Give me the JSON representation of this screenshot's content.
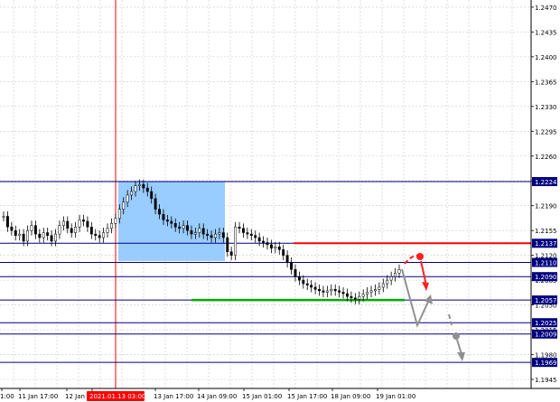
{
  "chart_data": {
    "type": "candlestick",
    "title": "",
    "xlabel": "",
    "ylabel": "",
    "ylim": [
      1.1945,
      1.2475
    ],
    "grid": true,
    "y_ticks": [
      "1.2470",
      "1.2435",
      "1.2400",
      "1.2365",
      "1.2330",
      "1.2295",
      "1.2260",
      "1.2225",
      "1.2190",
      "1.2155",
      "1.2120",
      "1.2085",
      "1.2050",
      "1.2015",
      "1.1980",
      "1.1945"
    ],
    "x_ticks": [
      "1:00",
      "11 Jan 17:00",
      "12 Jan 09:00",
      "13 Jan 03:00",
      "13 Jan 17:00",
      "14 Jan 09:00",
      "15 Jan 01:00",
      "15 Jan 17:00",
      "18 Jan 09:00",
      "19 Jan 01:00"
    ],
    "highlight_date": "2021.01.13 03:00",
    "levels": [
      {
        "label": "1.2224",
        "value": 1.2224,
        "color": "#000080"
      },
      {
        "label": "1.2137",
        "value": 1.2137,
        "color": "#000080"
      },
      {
        "label": "1.2110",
        "value": 1.211,
        "color": "#000080"
      },
      {
        "label": "1.2090",
        "value": 1.209,
        "color": "#000080"
      },
      {
        "label": "1.2057",
        "value": 1.2057,
        "color": "#000080"
      },
      {
        "label": "1.2025",
        "value": 1.2025,
        "color": "#000080"
      },
      {
        "label": "1.2009",
        "value": 1.2009,
        "color": "#000080"
      },
      {
        "label": "1.1969",
        "value": 1.1969,
        "color": "#000080"
      }
    ],
    "resistance_line": {
      "value": 1.2137,
      "color": "#ff0000"
    },
    "support_line": {
      "value": 1.2057,
      "color": "#00aa00"
    },
    "zone": {
      "from": 1.2224,
      "to": 1.2112,
      "color": "#99ccff"
    },
    "price_series": [
      1.2175,
      1.216,
      1.2155,
      1.2148,
      1.215,
      1.214,
      1.2155,
      1.2162,
      1.215,
      1.2145,
      1.2152,
      1.2148,
      1.214,
      1.215,
      1.2162,
      1.2168,
      1.2158,
      1.2152,
      1.216,
      1.217,
      1.2168,
      1.216,
      1.215,
      1.2148,
      1.2145,
      1.2152,
      1.2158,
      1.2165,
      1.2172,
      1.2185,
      1.2195,
      1.2205,
      1.221,
      1.2218,
      1.222,
      1.2215,
      1.221,
      1.22,
      1.2185,
      1.2178,
      1.217,
      1.2168,
      1.2165,
      1.216,
      1.2158,
      1.2162,
      1.2155,
      1.215,
      1.2152,
      1.2158,
      1.215,
      1.2148,
      1.2145,
      1.215,
      1.2152,
      1.2145,
      1.2125,
      1.212,
      1.216,
      1.2158,
      1.2152,
      1.215,
      1.2148,
      1.2145,
      1.214,
      1.2138,
      1.2135,
      1.213,
      1.2132,
      1.2128,
      1.212,
      1.211,
      1.21,
      1.209,
      1.2085,
      1.208,
      1.2078,
      1.2075,
      1.2072,
      1.207,
      1.2068,
      1.207,
      1.2072,
      1.207,
      1.2068,
      1.2066,
      1.2062,
      1.206,
      1.2058,
      1.2062,
      1.2065,
      1.2068,
      1.207,
      1.2072,
      1.2075,
      1.208,
      1.2085,
      1.209,
      1.2095,
      1.21
    ],
    "forecast": {
      "red": "down",
      "gray_main": "down-then-up",
      "gray_second": "down"
    }
  }
}
